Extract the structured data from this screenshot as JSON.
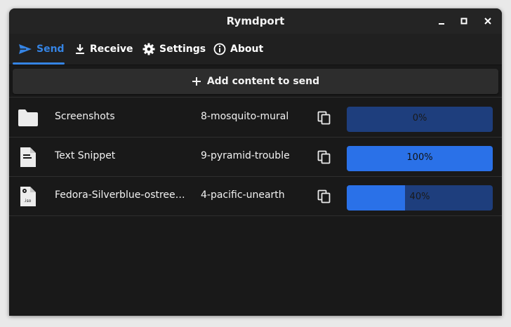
{
  "window": {
    "title": "Rymdport"
  },
  "tabs": [
    {
      "label": "Send",
      "icon": "send-icon",
      "active": true
    },
    {
      "label": "Receive",
      "icon": "download-icon",
      "active": false
    },
    {
      "label": "Settings",
      "icon": "gear-icon",
      "active": false
    },
    {
      "label": "About",
      "icon": "info-icon",
      "active": false
    }
  ],
  "add_button": {
    "label": "Add content to send"
  },
  "items": [
    {
      "name": "Screenshots",
      "icon": "folder-icon",
      "code": "8-mosquito-mural",
      "progress": 0,
      "progress_label": "0%"
    },
    {
      "name": "Text Snippet",
      "icon": "text-file-icon",
      "code": "9-pyramid-trouble",
      "progress": 1.0,
      "progress_label": "100%"
    },
    {
      "name": "Fedora-Silverblue-ostree…",
      "icon": "iso-file-icon",
      "icon_text": ".iso",
      "code": "4-pacific-unearth",
      "progress": 0.4,
      "progress_label": "40%"
    }
  ],
  "colors": {
    "accent": "#3584e4",
    "progress_fill": "#2a71e8",
    "progress_track": "#1e3e7d"
  }
}
